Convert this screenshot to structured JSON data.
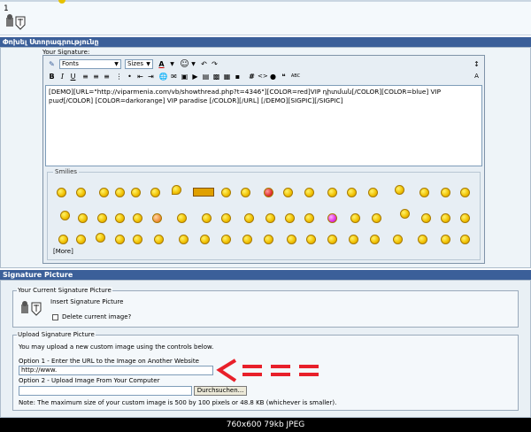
{
  "top": {
    "digit": "1"
  },
  "signature_bar": {
    "title": "Փոխել Ստորագրությունը"
  },
  "editor": {
    "label": "Your Signature:",
    "font_select": "Fonts",
    "size_select": "Sizes",
    "color_char": "A",
    "text": "[DEMO][URL=\"http://viparmenia.com/vb/showthread.php?t=4346\"][COLOR=red]VIP դիտման[/COLOR][COLOR=blue] VIP բաժ[/COLOR] [COLOR=darkorange] VIP paradise [/COLOR][/URL] [/DEMO][SIGPIC][/SIGPIC]",
    "smilies_legend": "Smilies",
    "more": "[More]",
    "abc": "ABC"
  },
  "picture_bar": {
    "title": "Signature Picture"
  },
  "current": {
    "legend": "Your Current Signature Picture",
    "insert_label": "Insert Signature Picture",
    "delete_label": "Delete current image?"
  },
  "upload": {
    "legend": "Upload Signature Picture",
    "intro": "You may upload a new custom image using the controls below.",
    "option1": "Option 1 - Enter the URL to the Image on Another Website",
    "url_value": "http://www.",
    "option2": "Option 2 - Upload Image From Your Computer",
    "browse_label": "Durchsuchen...",
    "note": "Note: The maximum size of your custom image is 500 by 100 pixels or 48.8 KB (whichever is smaller)."
  },
  "annotation": {
    "arrow_text": "<===",
    "color": "#e8202a"
  },
  "footer": {
    "info": "760x600  79kb  JPEG"
  }
}
